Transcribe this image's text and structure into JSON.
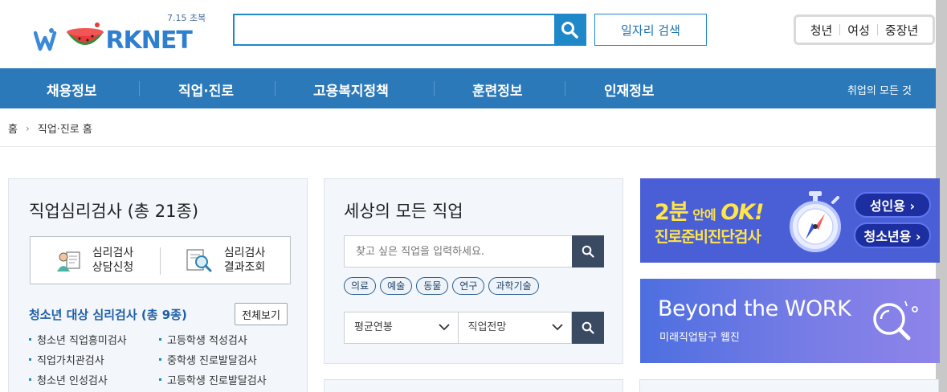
{
  "header": {
    "logo_date": "7.15 초복",
    "logo_text": "RKNET",
    "search_placeholder": "",
    "job_search_label": "일자리 검색",
    "user_types": [
      "청년",
      "여성",
      "중장년"
    ]
  },
  "gnb": {
    "items": [
      "채용정보",
      "직업·진로",
      "고용복지정책",
      "훈련정보",
      "인재정보"
    ],
    "all_label": "취업의 모든 것"
  },
  "breadcrumb": {
    "home": "홈",
    "current": "직업·진로 홈"
  },
  "psych": {
    "title": "직업심리검사 (총 21종)",
    "btn1": [
      "심리검사",
      "상담신청"
    ],
    "btn2": [
      "심리검사",
      "결과조회"
    ],
    "youth_title": "청소년 대상 심리검사 (총 9종)",
    "view_all": "전체보기",
    "left_tests": [
      "청소년 직업흥미검사",
      "직업가치관검사",
      "청소년 인성검사"
    ],
    "right_tests": [
      "고등학생 적성검사",
      "중학생 진로발달검사",
      "고등학생 진로발달검사"
    ]
  },
  "jobs": {
    "title": "세상의 모든 직업",
    "search_placeholder": "찾고 싶은 직업을 입력하세요.",
    "tags": [
      "의료",
      "예술",
      "동물",
      "연구",
      "과학기술"
    ],
    "select1": "평균연봉",
    "select2": "직업전망"
  },
  "banner1": {
    "big": "2분",
    "mid": " 안에 ",
    "ok": "OK!",
    "sub": "진로준비진단검사",
    "adult": "성인용 ›",
    "youth": "청소년용 ›"
  },
  "banner2": {
    "title": "Beyond the WORK",
    "sub": "미래직업탐구 웹진"
  },
  "colors": {
    "primary": "#1e88c9",
    "gnb": "#2b79b9",
    "dark_button": "#3b4a63",
    "banner1_bg": "#4a5fd6"
  }
}
